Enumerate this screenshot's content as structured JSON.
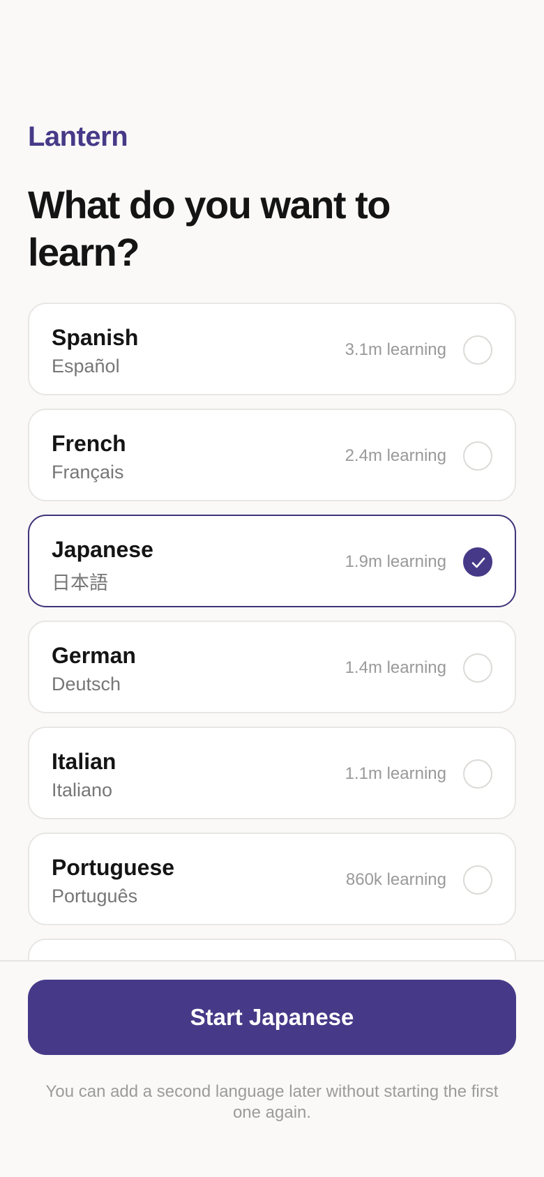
{
  "app": {
    "brand": "Lantern"
  },
  "header": {
    "title": "What do you want to learn?"
  },
  "languages": [
    {
      "name": "Spanish",
      "native": "Español",
      "learners": "3.1m learning",
      "selected": false
    },
    {
      "name": "French",
      "native": "Français",
      "learners": "2.4m learning",
      "selected": false
    },
    {
      "name": "Japanese",
      "native": "日本語",
      "learners": "1.9m learning",
      "selected": true
    },
    {
      "name": "German",
      "native": "Deutsch",
      "learners": "1.4m learning",
      "selected": false
    },
    {
      "name": "Italian",
      "native": "Italiano",
      "learners": "1.1m learning",
      "selected": false
    },
    {
      "name": "Portuguese",
      "native": "Português",
      "learners": "860k learning",
      "selected": false
    }
  ],
  "footer": {
    "cta_label": "Start Japanese",
    "hint": "You can add a second language later without starting the first one again."
  },
  "colors": {
    "accent": "#463a88",
    "background": "#faf9f8"
  },
  "icons": {
    "selected": "check-icon"
  }
}
